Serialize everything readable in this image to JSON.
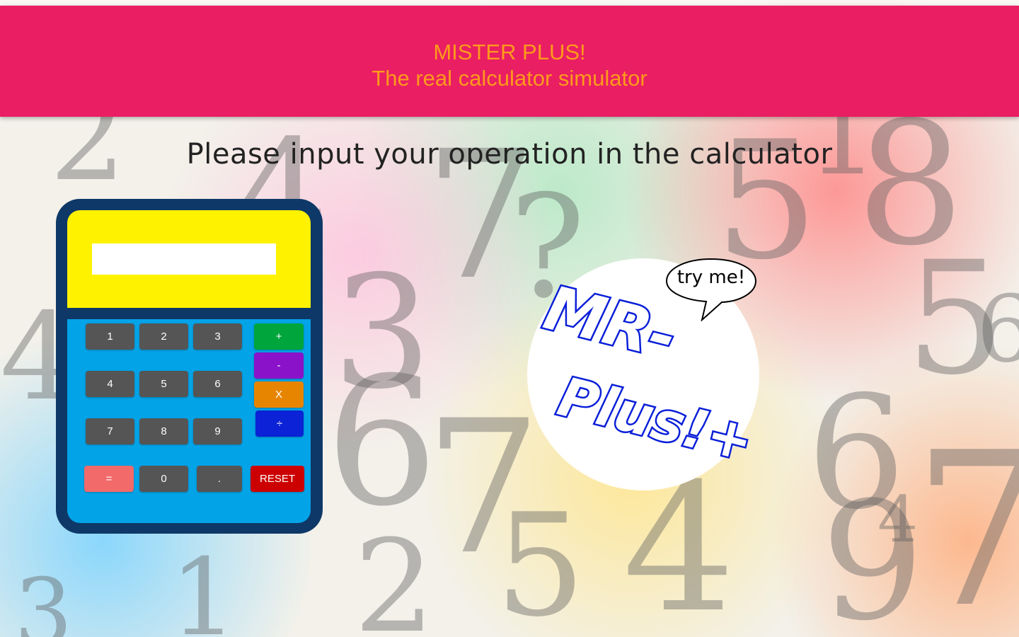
{
  "header": {
    "title": "MISTER PLUS!",
    "subtitle": "The real calculator simulator"
  },
  "main": {
    "prompt": "Please input your operation in the calculator"
  },
  "calculator": {
    "display_value": "",
    "keys": {
      "one": "1",
      "two": "2",
      "three": "3",
      "four": "4",
      "five": "5",
      "six": "6",
      "seven": "7",
      "eight": "8",
      "nine": "9",
      "zero": "0",
      "dot": ".",
      "plus": "+",
      "minus": "-",
      "times": "X",
      "divide": "÷",
      "equals": "=",
      "reset": "RESET"
    },
    "colors": {
      "frame": "#0e3867",
      "screen_area": "#fff200",
      "keys_area": "#03a3e7",
      "number_key": "#555555",
      "plus": "#00a53c",
      "minus": "#8a12c9",
      "times": "#e88500",
      "divide": "#0b22d6",
      "equals": "#f26a6a",
      "reset": "#cc0000"
    }
  },
  "logo": {
    "line1": "MR-",
    "line2": "Plus!+",
    "bubble_text": "try me!"
  },
  "theme": {
    "header_bg": "#e91e63",
    "header_text": "#ff9a1c"
  }
}
